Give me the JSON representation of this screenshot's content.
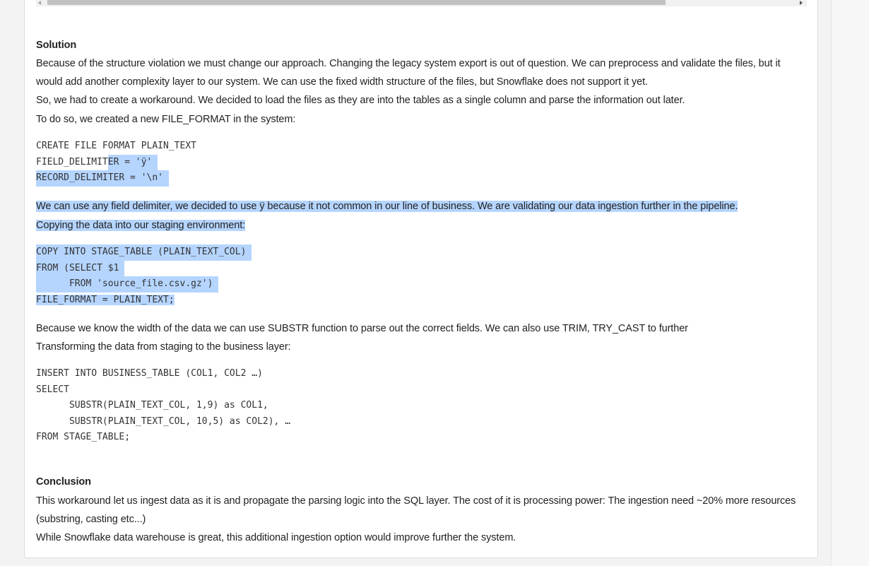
{
  "solution": {
    "heading": "Solution",
    "p1a": "Because of the structure violation we must change our approach. Changing the legacy system export is out of question. We can preprocess and validate the files, but it",
    "p1b": "would add another complexity layer to our system. We can use the fixed width structure of the files, but Snowflake does not support it yet.",
    "p2": "So, we had to create a workaround. We decided to load the files as they are into the tables as a single column and parse the information out later.",
    "p3": "To do so, we created a new FILE_FORMAT in the system:"
  },
  "code1": {
    "l1": "CREATE FILE FORMAT PLAIN_TEXT",
    "l2a": "FIELD_DELIMIT",
    "l2b": "ER = 'ÿ'",
    "l3": "RECORD_DELIMITER = '\\n'"
  },
  "delimiter": {
    "p1": "We can use any field delimiter, we decided to use ÿ because it not common in our line of business. We are validating our data ingestion further in the pipeline.",
    "p2": "Copying the data into our staging environment:"
  },
  "code2": {
    "l1": "COPY INTO STAGE_TABLE (PLAIN_TEXT_COL)",
    "l2": "FROM (SELECT $1",
    "l3": "      FROM 'source_file.csv.gz')",
    "l4": "FILE_FORMAT = PLAIN_TEXT;"
  },
  "substr": {
    "p1": "Because we know the width of the data we can use SUBSTR function to parse out the correct fields. We can also use TRIM, TRY_CAST to further",
    "p2": "Transforming the data from staging to the business layer:"
  },
  "code3": {
    "l1": "INSERT INTO BUSINESS_TABLE (COL1, COL2 …)",
    "l2": "SELECT",
    "l3": "      SUBSTR(PLAIN_TEXT_COL, 1,9) as COL1,",
    "l4": "      SUBSTR(PLAIN_TEXT_COL, 10,5) as COL2), …",
    "l5": "FROM STAGE_TABLE;"
  },
  "conclusion": {
    "heading": "Conclusion",
    "p1a": "This workaround let us ingest data as it is and propagate the parsing logic into the SQL layer. The cost of it is processing power: The ingestion need ~20% more resources",
    "p1b": "(substring, casting etc...)",
    "p2": "While Snowflake data warehouse is great, this additional ingestion option would improve further the system."
  },
  "colors": {
    "selection": "#b5d5ff",
    "text": "#222222",
    "code": "#333333"
  }
}
